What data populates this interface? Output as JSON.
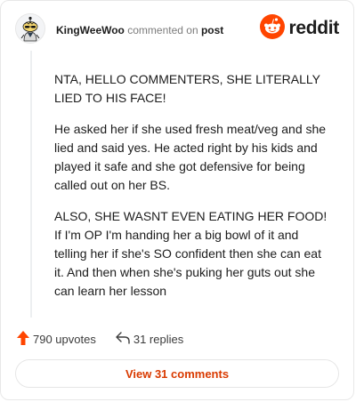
{
  "header": {
    "author": "KingWeeWoo",
    "verb": "commented on",
    "target": "post",
    "brand": "reddit"
  },
  "comment": {
    "paragraphs": [
      "NTA, HELLO COMMENTERS, SHE LITERALLY LIED TO HIS FACE!",
      "He asked her if she used fresh meat/veg and she lied and said yes. He acted right by his kids and played it safe and she got defensive for being called out on her BS.",
      "ALSO, SHE WASNT EVEN EATING HER FOOD! If I'm OP I'm handing her a big bowl of it and telling her if she's SO confident then she can eat it. And then when she's puking her guts out she can learn her lesson"
    ]
  },
  "actions": {
    "upvotes": "790 upvotes",
    "replies": "31 replies",
    "view_comments": "View 31 comments"
  },
  "icons": {
    "avatar": "snoo-avatar-icon",
    "brand": "reddit-logo-icon",
    "upvote": "upvote-arrow-icon",
    "reply": "reply-arrow-icon"
  },
  "colors": {
    "brand_orange": "#ff4500",
    "upvote_orange": "#ff4500",
    "link_orange": "#d93a00"
  }
}
